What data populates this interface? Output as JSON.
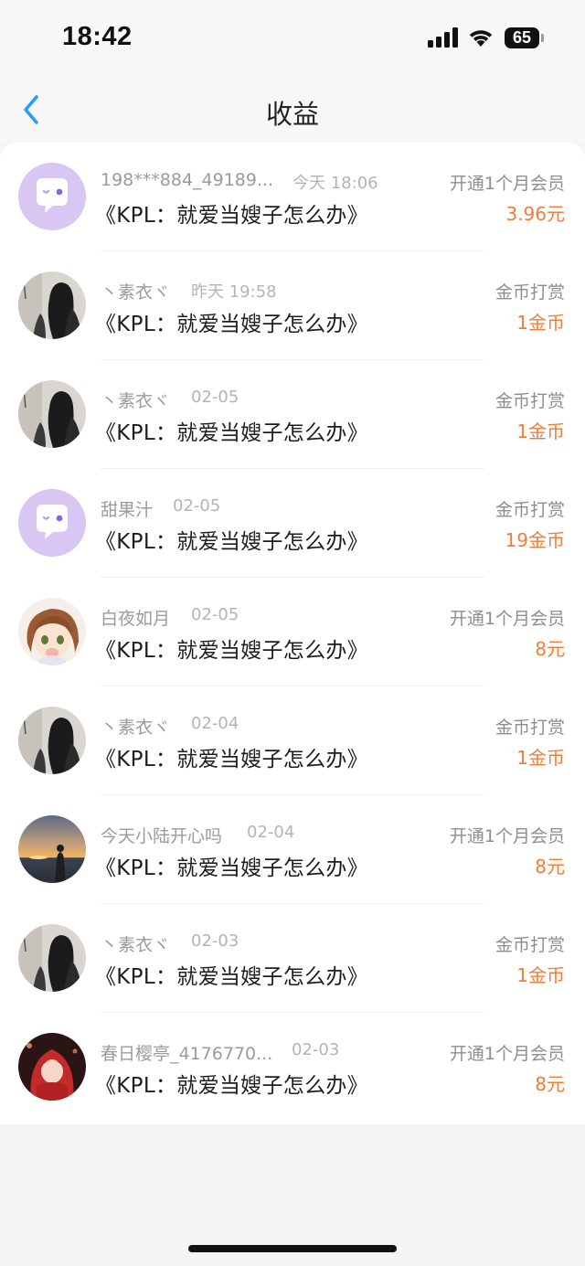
{
  "status_bar": {
    "time": "18:42",
    "battery": "65"
  },
  "nav": {
    "title": "收益",
    "back_icon": "chevron-left-icon"
  },
  "colors": {
    "amount": "#f07d38",
    "back": "#2e9bf0",
    "placeholder_avatar": "#d8c6f3"
  },
  "items": [
    {
      "name": "198***884_49189...",
      "date": "今天 18:06",
      "title": "《KPL：就爱当嫂子怎么办》",
      "type": "开通1个月会员",
      "amount": "3.96元",
      "avatar": "placeholder-chat-avatar"
    },
    {
      "name": "丶素衣ヾ",
      "date": "昨天 19:58",
      "title": "《KPL：就爱当嫂子怎么办》",
      "type": "金币打赏",
      "amount": "1金币",
      "avatar": "dark-silhouette-avatar"
    },
    {
      "name": "丶素衣ヾ",
      "date": "02-05",
      "title": "《KPL：就爱当嫂子怎么办》",
      "type": "金币打赏",
      "amount": "1金币",
      "avatar": "dark-silhouette-avatar"
    },
    {
      "name": "甜果汁",
      "date": "02-05",
      "title": "《KPL：就爱当嫂子怎么办》",
      "type": "金币打赏",
      "amount": "19金币",
      "avatar": "placeholder-chat-avatar"
    },
    {
      "name": "白夜如月",
      "date": "02-05",
      "title": "《KPL：就爱当嫂子怎么办》",
      "type": "开通1个月会员",
      "amount": "8元",
      "avatar": "anime-girl-avatar"
    },
    {
      "name": "丶素衣ヾ",
      "date": "02-04",
      "title": "《KPL：就爱当嫂子怎么办》",
      "type": "金币打赏",
      "amount": "1金币",
      "avatar": "dark-silhouette-avatar"
    },
    {
      "name": "今天小陆开心吗",
      "date": "02-04",
      "title": "《KPL：就爱当嫂子怎么办》",
      "type": "开通1个月会员",
      "amount": "8元",
      "avatar": "sunset-avatar"
    },
    {
      "name": "丶素衣ヾ",
      "date": "02-03",
      "title": "《KPL：就爱当嫂子怎么办》",
      "type": "金币打赏",
      "amount": "1金币",
      "avatar": "dark-silhouette-avatar"
    },
    {
      "name": "春日樱亭_4176770...",
      "date": "02-03",
      "title": "《KPL：就爱当嫂子怎么办》",
      "type": "开通1个月会员",
      "amount": "8元",
      "avatar": "red-hood-avatar"
    }
  ]
}
